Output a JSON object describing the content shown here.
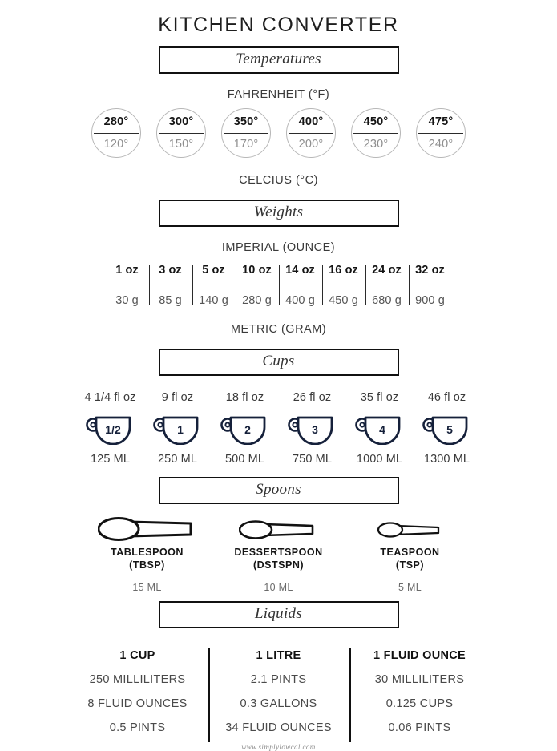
{
  "title": "KITCHEN CONVERTER",
  "footer": "www.simplylowcal.com",
  "temperatures": {
    "section_label": "Temperatures",
    "top_caption": "FAHRENHEIT (°F)",
    "bottom_caption": "CELCIUS (°C)",
    "items": [
      {
        "f": "280°",
        "c": "120°"
      },
      {
        "f": "300°",
        "c": "150°"
      },
      {
        "f": "350°",
        "c": "170°"
      },
      {
        "f": "400°",
        "c": "200°"
      },
      {
        "f": "450°",
        "c": "230°"
      },
      {
        "f": "475°",
        "c": "240°"
      }
    ]
  },
  "weights": {
    "section_label": "Weights",
    "top_caption": "IMPERIAL (OUNCE)",
    "bottom_caption": "METRIC (GRAM)",
    "items": [
      {
        "imperial": "1 oz",
        "metric": "30 g"
      },
      {
        "imperial": "3 oz",
        "metric": "85 g"
      },
      {
        "imperial": "5 oz",
        "metric": "140 g"
      },
      {
        "imperial": "10 oz",
        "metric": "280 g"
      },
      {
        "imperial": "14 oz",
        "metric": "400 g"
      },
      {
        "imperial": "16 oz",
        "metric": "450 g"
      },
      {
        "imperial": "24 oz",
        "metric": "680 g"
      },
      {
        "imperial": "32 oz",
        "metric": "900 g"
      }
    ]
  },
  "cups": {
    "section_label": "Cups",
    "items": [
      {
        "floz": "4 1/4 fl oz",
        "cup": "1/2",
        "ml": "125 ML"
      },
      {
        "floz": "9 fl oz",
        "cup": "1",
        "ml": "250 ML"
      },
      {
        "floz": "18 fl oz",
        "cup": "2",
        "ml": "500 ML"
      },
      {
        "floz": "26 fl oz",
        "cup": "3",
        "ml": "750 ML"
      },
      {
        "floz": "35 fl oz",
        "cup": "4",
        "ml": "1000 ML"
      },
      {
        "floz": "46 fl oz",
        "cup": "5",
        "ml": "1300 ML"
      }
    ]
  },
  "spoons": {
    "section_label": "Spoons",
    "items": [
      {
        "name": "TABLESPOON",
        "abbr": "(TBSP)",
        "ml": "15 ML"
      },
      {
        "name": "DESSERTSPOON",
        "abbr": "(DSTSPN)",
        "ml": "10 ML"
      },
      {
        "name": "TEASPOON",
        "abbr": "(TSP)",
        "ml": "5 ML"
      }
    ]
  },
  "liquids": {
    "section_label": "Liquids",
    "columns": [
      {
        "head": "1 CUP",
        "l1": "250 MILLILITERS",
        "l2": "8 FLUID OUNCES",
        "l3": "0.5 PINTS"
      },
      {
        "head": "1 LITRE",
        "l1": "2.1 PINTS",
        "l2": "0.3 GALLONS",
        "l3": "34 FLUID OUNCES"
      },
      {
        "head": "1 FLUID OUNCE",
        "l1": "30 MILLILITERS",
        "l2": "0.125 CUPS",
        "l3": "0.06 PINTS"
      }
    ]
  },
  "colors": {
    "ink": "#1e1e1e",
    "muted": "#8e8e8e",
    "cup_navy": "#15203a",
    "circle_stroke": "#b7b7b7"
  }
}
